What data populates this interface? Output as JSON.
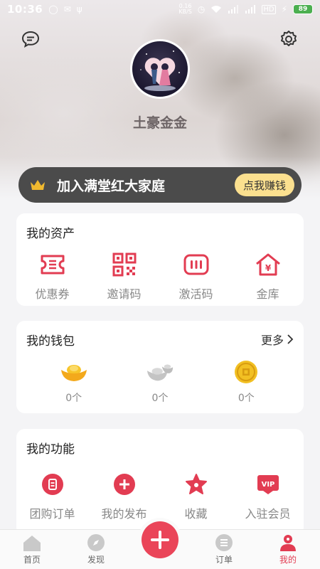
{
  "status_bar": {
    "time": "10:36",
    "net_speed_top": "0.16",
    "net_speed_bottom": "KB/S",
    "battery": "89"
  },
  "profile": {
    "username": "土豪金金"
  },
  "join_banner": {
    "title": "加入满堂红大家庭",
    "button_label": "点我赚钱"
  },
  "assets": {
    "title": "我的资产",
    "items": [
      {
        "label": "优惠券",
        "icon": "coupon-icon"
      },
      {
        "label": "邀请码",
        "icon": "qrcode-icon"
      },
      {
        "label": "激活码",
        "icon": "activation-code-icon"
      },
      {
        "label": "金库",
        "icon": "vault-house-icon"
      }
    ]
  },
  "wallet": {
    "title": "我的钱包",
    "more_label": "更多",
    "items": [
      {
        "count": "0个",
        "icon": "gold-ingot-icon"
      },
      {
        "count": "0个",
        "icon": "silver-ingot-icon"
      },
      {
        "count": "0个",
        "icon": "copper-coin-icon"
      }
    ]
  },
  "functions": {
    "title": "我的功能",
    "items": [
      {
        "label": "团购订单",
        "icon": "group-order-icon"
      },
      {
        "label": "我的发布",
        "icon": "publish-plus-icon"
      },
      {
        "label": "收藏",
        "icon": "favorite-star-icon"
      },
      {
        "label": "入驻会员",
        "icon": "vip-icon"
      }
    ]
  },
  "bottom_nav": {
    "items": [
      {
        "label": "首页",
        "icon": "home-icon"
      },
      {
        "label": "发现",
        "icon": "compass-icon"
      },
      {
        "label": "订单",
        "icon": "order-list-icon"
      },
      {
        "label": "我的",
        "icon": "profile-icon"
      }
    ],
    "active": "我的"
  },
  "colors": {
    "accent": "#e23c52",
    "banner_bg": "#4b4b4b",
    "banner_button": "#fbe08f",
    "crown": "#f0b92f"
  }
}
